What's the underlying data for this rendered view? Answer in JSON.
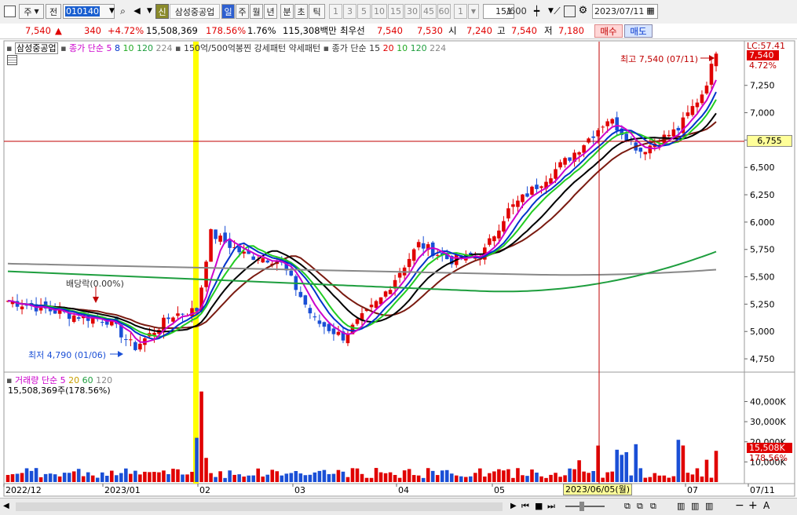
{
  "toolbar": {
    "mode1": "주",
    "mode2": "전",
    "stock_code": "010140",
    "info_badge": "신",
    "stock_name": "삼성중공업",
    "periods": [
      "일",
      "주",
      "월",
      "년",
      "분",
      "초",
      "틱"
    ],
    "active_period": "일",
    "intervals": [
      "1",
      "3",
      "5",
      "10",
      "15",
      "30",
      "45",
      "60"
    ],
    "custom_interval": "1",
    "count": "151",
    "count_total": "/600",
    "date": "2023/07/11"
  },
  "quote": {
    "price": "7,540",
    "change_arrow": "▲",
    "change": "340",
    "change_pct": "+4.72%",
    "volume": "15,508,369",
    "volume_ratio": "178.56%",
    "turnover": "1.76%",
    "amount": "115,308백만",
    "best_label": "최우선",
    "best_ask": "7,540",
    "best_bid": "7,530",
    "open_label": "시",
    "open": "7,240",
    "high_label": "고",
    "high": "7,540",
    "low_label": "저",
    "low": "7,180",
    "buy_button": "매수",
    "sell_button": "매도"
  },
  "legend": {
    "stock": "삼성중공업",
    "ma_label": "종가 단순",
    "ma_periods": [
      "5",
      "8",
      "10",
      "120",
      "224"
    ],
    "pattern_text": "150억/500억봉찐 강세패턴  약세패턴",
    "ma2_label": "종가 단순",
    "ma2_periods": [
      "15",
      "20",
      "10",
      "120",
      "224"
    ],
    "volume_label": "거래량",
    "volume_ma_label": "단순",
    "volume_ma_periods": [
      "5",
      "20",
      "60",
      "120"
    ],
    "volume_value": "15,508,369주(178.56%)"
  },
  "annotations": {
    "high": "최고 7,540 (07/11)",
    "low": "최저 4,790 (01/06)",
    "dividend": "배당락(0.00%)",
    "lc": "LC:57.41",
    "price_tag": "7,540",
    "pct_tag": "4.72%",
    "crosshair_price": "6,755",
    "crosshair_date": "2023/06/05(월)",
    "volume_tag": "15,508K",
    "volume_pct_tag": "178.56%"
  },
  "price_axis": [
    "7,250",
    "7,000",
    "6,750",
    "6,500",
    "6,250",
    "6,000",
    "5,750",
    "5,500",
    "5,250",
    "5,000",
    "4,750"
  ],
  "volume_axis": [
    "40,000K",
    "30,000K",
    "20,000K",
    "10,000K"
  ],
  "time_axis": [
    "2022/12",
    "2023/01",
    "02",
    "03",
    "04",
    "05",
    "07",
    "07/11"
  ],
  "colors": {
    "up": "#e00000",
    "down": "#1a4fd6",
    "ma5": "#cc00cc",
    "ma8": "#0033cc",
    "ma10": "#22cc22",
    "ma120": "#1e9e3e",
    "ma224": "#888888",
    "ma_dark": "#7a1a10",
    "highlight": "#ffff00",
    "crosshair": "#c00000"
  },
  "chart_data": {
    "type": "candlestick",
    "x": [
      "2022/12",
      "2023/01",
      "01/06",
      "02",
      "03",
      "04",
      "05",
      "06/05",
      "07",
      "07/11"
    ],
    "y": [
      5250,
      5150,
      4790,
      5900,
      5700,
      5000,
      5750,
      6755,
      6900,
      7540
    ],
    "ylim": [
      4650,
      7650
    ],
    "high": {
      "date": "07/11",
      "value": 7540
    },
    "low": {
      "date": "01/06",
      "value": 4790
    },
    "last": {
      "date": "07/11",
      "open": 7240,
      "high": 7540,
      "low": 7180,
      "close": 7540,
      "volume": 15508369
    }
  }
}
